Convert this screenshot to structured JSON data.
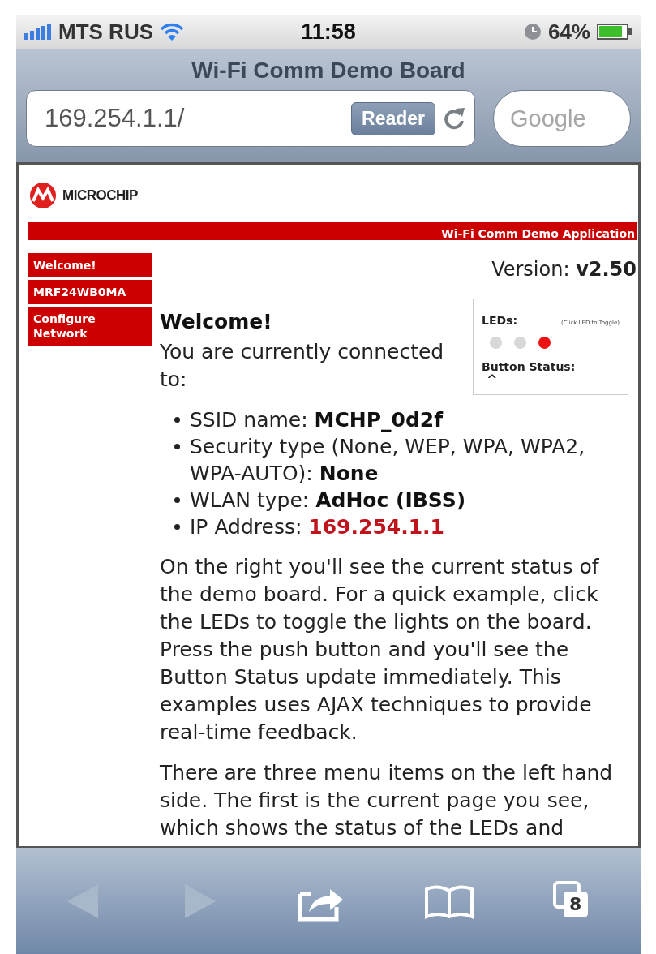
{
  "status_bar": {
    "carrier": "MTS RUS",
    "time": "11:58",
    "battery": "64%"
  },
  "browser": {
    "title": "Wi-Fi Comm Demo Board",
    "url": "169.254.1.1/",
    "reader_button": "Reader",
    "search_placeholder": "Google"
  },
  "page": {
    "logo_text": "MICROCHIP",
    "banner": "Wi-Fi Comm Demo Application",
    "nav": [
      {
        "label": "Welcome!"
      },
      {
        "label": "MRF24WB0MA"
      },
      {
        "label": "Configure Network"
      }
    ],
    "version_label": "Version:",
    "version": "v2.50",
    "status_panel": {
      "leds_label": "LEDs:",
      "leds_hint": "(Click LED to Toggle)",
      "leds": [
        {
          "on": false
        },
        {
          "on": false
        },
        {
          "on": true
        }
      ],
      "button_label": "Button Status:",
      "button_value": "^"
    },
    "heading": "Welcome!",
    "intro": "You are currently connected to:",
    "details": [
      {
        "label": "SSID name:",
        "value": "MCHP_0d2f",
        "highlight": false
      },
      {
        "label": "Security type (None, WEP, WPA, WPA2, WPA-AUTO):",
        "value": "None",
        "highlight": false
      },
      {
        "label": "WLAN type:",
        "value": "AdHoc (IBSS)",
        "highlight": false
      },
      {
        "label": "IP Address:",
        "value": "169.254.1.1",
        "highlight": true
      }
    ],
    "paragraphs": [
      "On the right you'll see the current status of the demo board. For a quick example, click the LEDs to toggle the lights on the board. Press the push button and you'll see the Button Status update immediately. This examples uses AJAX techniques to provide real-time feedback.",
      "There are three menu items on the left hand side. The first is the current page you see, which shows the status of the LEDs and"
    ]
  },
  "toolbar": {
    "tab_count": "8"
  }
}
